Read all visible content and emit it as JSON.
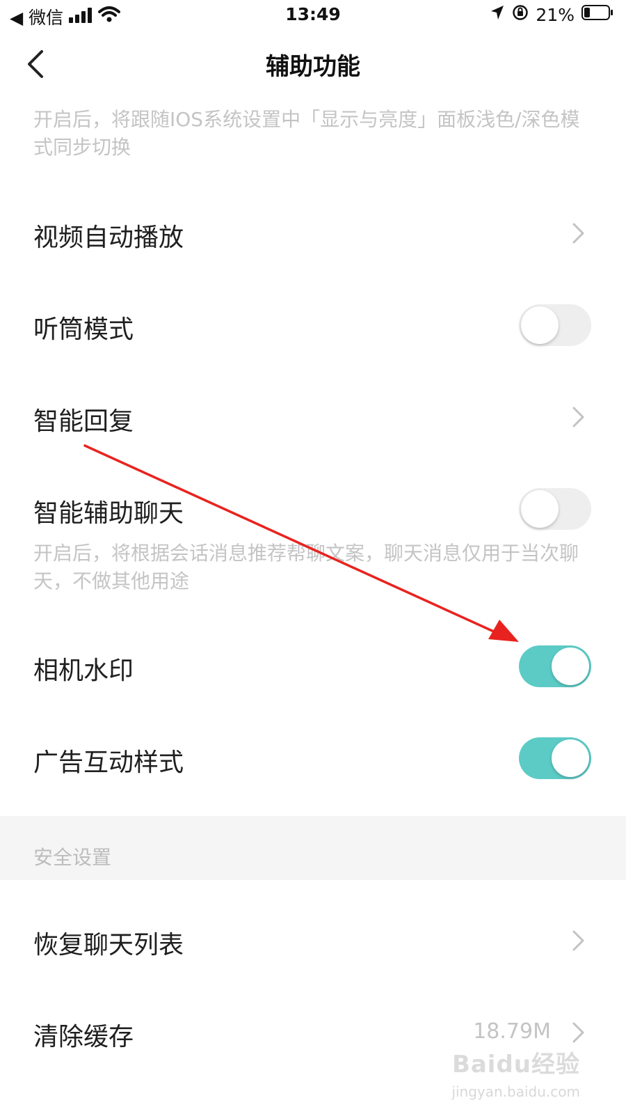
{
  "status_bar": {
    "back_app": "◀ 微信",
    "time": "13:49",
    "battery": "21%"
  },
  "nav": {
    "title": "辅助功能"
  },
  "top_desc": "开启后，将跟随IOS系统设置中「显示与亮度」面板浅色/深色模式同步切换",
  "rows": [
    {
      "label": "视频自动播放",
      "control": "chevron"
    },
    {
      "label": "听筒模式",
      "control": "toggle",
      "on": false
    },
    {
      "label": "智能回复",
      "control": "chevron"
    },
    {
      "label": "智能辅助聊天",
      "control": "toggle",
      "on": false
    },
    {
      "label": "相机水印",
      "control": "toggle",
      "on": true
    },
    {
      "label": "广告互动样式",
      "control": "toggle",
      "on": true
    }
  ],
  "smart_chat_desc": "开启后，将根据会话消息推荐帮聊文案，聊天消息仅用于当次聊天，不做其他用途",
  "section": {
    "title": "安全设置"
  },
  "security_rows": [
    {
      "label": "恢复聊天列表",
      "control": "chevron"
    },
    {
      "label": "清除缓存",
      "control": "chevron",
      "value": "18.79M"
    }
  ],
  "watermark": {
    "brand": "Baidu经验",
    "site": "jingyan.baidu.com"
  },
  "colors": {
    "toggle_on": "#5ccbc6",
    "toggle_off": "#eeeeee",
    "annotation_arrow": "#e8231f",
    "hint_text": "#c4c4c4"
  },
  "icons": [
    "back-arrow-icon",
    "signal-icon",
    "wifi-icon",
    "location-icon",
    "rotation-lock-icon",
    "battery-icon",
    "chevron-right-icon"
  ]
}
